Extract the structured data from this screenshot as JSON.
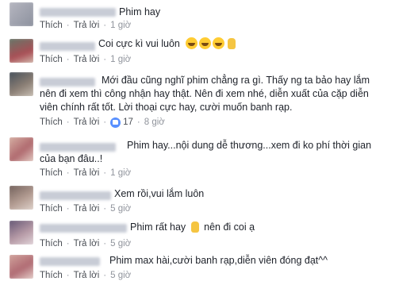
{
  "comments": [
    {
      "text": "Phim hay",
      "actions": {
        "like": "Thích",
        "reply": "Trả lời",
        "time": "1 giờ"
      }
    },
    {
      "text": "Coi cực kì vui luôn",
      "actions": {
        "like": "Thích",
        "reply": "Trả lời",
        "time": "1 giờ"
      },
      "emojis": [
        "laugh-emoji",
        "laugh-emoji",
        "laugh-emoji",
        "ok-hand-emoji"
      ]
    },
    {
      "text": "Mới đầu cũng nghĩ phim chẳng ra gì. Thấy ng ta bảo hay lắm nên đi xem thì công nhận hay thật. Nên đi xem nhé, diễn xuất của cặp diễn viên chính rất tốt. Lời thoại cực hay, cười muốn banh rạp.",
      "actions": {
        "like": "Thích",
        "reply": "Trả lời",
        "likes_count": "17",
        "time": "8 giờ"
      }
    },
    {
      "text": "Phim hay...nội dung dễ thương...xem đi ko phí thời gian của bạn đâu..!",
      "actions": {
        "like": "Thích",
        "reply": "Trả lời",
        "time": "1 giờ"
      }
    },
    {
      "text": "Xem rồi,vui lắm luôn",
      "actions": {
        "like": "Thích",
        "reply": "Trả lời",
        "time": "5 giờ"
      }
    },
    {
      "text_before": "Phim rất hay",
      "text_after": "nên đi coi ạ",
      "actions": {
        "like": "Thích",
        "reply": "Trả lời",
        "time": "5 giờ"
      },
      "emojis": [
        "thumbs-up-emoji"
      ]
    },
    {
      "text": "Phim max hài,cười banh rạp,diễn viên đóng đạt^^",
      "actions": {
        "like": "Thích",
        "reply": "Trả lời",
        "time": "5 giờ"
      }
    }
  ],
  "colors": {
    "link": "#4b4f56",
    "meta": "#90949c",
    "text": "#1d2129",
    "like_blue": "#5890ff"
  }
}
